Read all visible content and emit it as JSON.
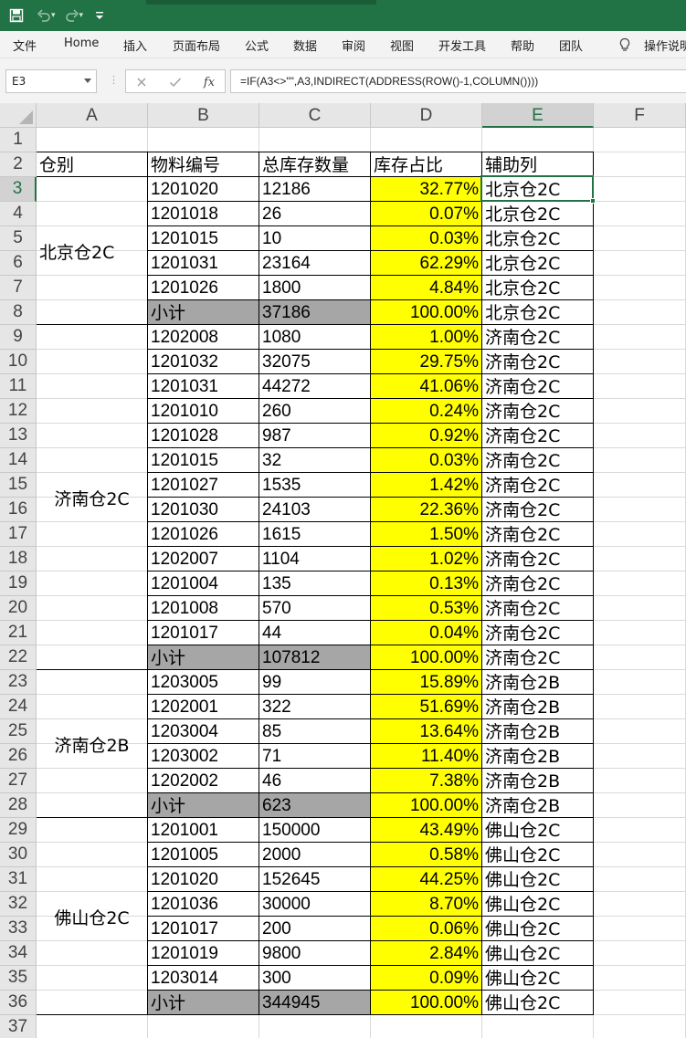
{
  "title_bar": {
    "accent": "#217346"
  },
  "ribbon": {
    "tabs": [
      "文件",
      "Home",
      "插入",
      "页面布局",
      "公式",
      "数据",
      "审阅",
      "视图",
      "开发工具",
      "帮助",
      "团队"
    ],
    "help_label": "操作说明"
  },
  "formula_bar": {
    "name_box": "E3",
    "formula": "=IF(A3<>\"\",A3,INDIRECT(ADDRESS(ROW()-1,COLUMN())))"
  },
  "columns": [
    "A",
    "B",
    "C",
    "D",
    "E",
    "F"
  ],
  "selected_column": "E",
  "selected_row": 3,
  "row_numbers": [
    1,
    2,
    3,
    4,
    5,
    6,
    7,
    8,
    9,
    10,
    11,
    12,
    13,
    14,
    15,
    16,
    17,
    18,
    19,
    20,
    21,
    22,
    23,
    24,
    25,
    26,
    27,
    28,
    29,
    30,
    31,
    32,
    33,
    34,
    35,
    36,
    37
  ],
  "sheet": {
    "headers": [
      "仓别",
      "物料编号",
      "总库存数量",
      "库存占比",
      "辅助列"
    ],
    "groups": [
      {
        "warehouse": "北京仓2C",
        "rows": [
          [
            "1201020",
            "12186",
            "32.77%",
            "北京仓2C"
          ],
          [
            "1201018",
            "26",
            "0.07%",
            "北京仓2C"
          ],
          [
            "1201015",
            "10",
            "0.03%",
            "北京仓2C"
          ],
          [
            "1201031",
            "23164",
            "62.29%",
            "北京仓2C"
          ],
          [
            "1201026",
            "1800",
            "4.84%",
            "北京仓2C"
          ],
          [
            "小计",
            "37186",
            "100.00%",
            "北京仓2C"
          ]
        ]
      },
      {
        "warehouse": "济南仓2C",
        "rows": [
          [
            "1202008",
            "1080",
            "1.00%",
            "济南仓2C"
          ],
          [
            "1201032",
            "32075",
            "29.75%",
            "济南仓2C"
          ],
          [
            "1201031",
            "44272",
            "41.06%",
            "济南仓2C"
          ],
          [
            "1201010",
            "260",
            "0.24%",
            "济南仓2C"
          ],
          [
            "1201028",
            "987",
            "0.92%",
            "济南仓2C"
          ],
          [
            "1201015",
            "32",
            "0.03%",
            "济南仓2C"
          ],
          [
            "1201027",
            "1535",
            "1.42%",
            "济南仓2C"
          ],
          [
            "1201030",
            "24103",
            "22.36%",
            "济南仓2C"
          ],
          [
            "1201026",
            "1615",
            "1.50%",
            "济南仓2C"
          ],
          [
            "1202007",
            "1104",
            "1.02%",
            "济南仓2C"
          ],
          [
            "1201004",
            "135",
            "0.13%",
            "济南仓2C"
          ],
          [
            "1201008",
            "570",
            "0.53%",
            "济南仓2C"
          ],
          [
            "1201017",
            "44",
            "0.04%",
            "济南仓2C"
          ],
          [
            "小计",
            "107812",
            "100.00%",
            "济南仓2C"
          ]
        ]
      },
      {
        "warehouse": "济南仓2B",
        "rows": [
          [
            "1203005",
            "99",
            "15.89%",
            "济南仓2B"
          ],
          [
            "1202001",
            "322",
            "51.69%",
            "济南仓2B"
          ],
          [
            "1203004",
            "85",
            "13.64%",
            "济南仓2B"
          ],
          [
            "1203002",
            "71",
            "11.40%",
            "济南仓2B"
          ],
          [
            "1202002",
            "46",
            "7.38%",
            "济南仓2B"
          ],
          [
            "小计",
            "623",
            "100.00%",
            "济南仓2B"
          ]
        ]
      },
      {
        "warehouse": "佛山仓2C",
        "rows": [
          [
            "1201001",
            "150000",
            "43.49%",
            "佛山仓2C"
          ],
          [
            "1201005",
            "2000",
            "0.58%",
            "佛山仓2C"
          ],
          [
            "1201020",
            "152645",
            "44.25%",
            "佛山仓2C"
          ],
          [
            "1201036",
            "30000",
            "8.70%",
            "佛山仓2C"
          ],
          [
            "1201017",
            "200",
            "0.06%",
            "佛山仓2C"
          ],
          [
            "1201019",
            "9800",
            "2.84%",
            "佛山仓2C"
          ],
          [
            "1203014",
            "300",
            "0.09%",
            "佛山仓2C"
          ],
          [
            "小计",
            "344945",
            "100.00%",
            "佛山仓2C"
          ]
        ]
      }
    ]
  },
  "colors": {
    "ratio_fill": "#ffff00",
    "subtotal_fill": "#a6a6a6",
    "selection": "#217346"
  }
}
